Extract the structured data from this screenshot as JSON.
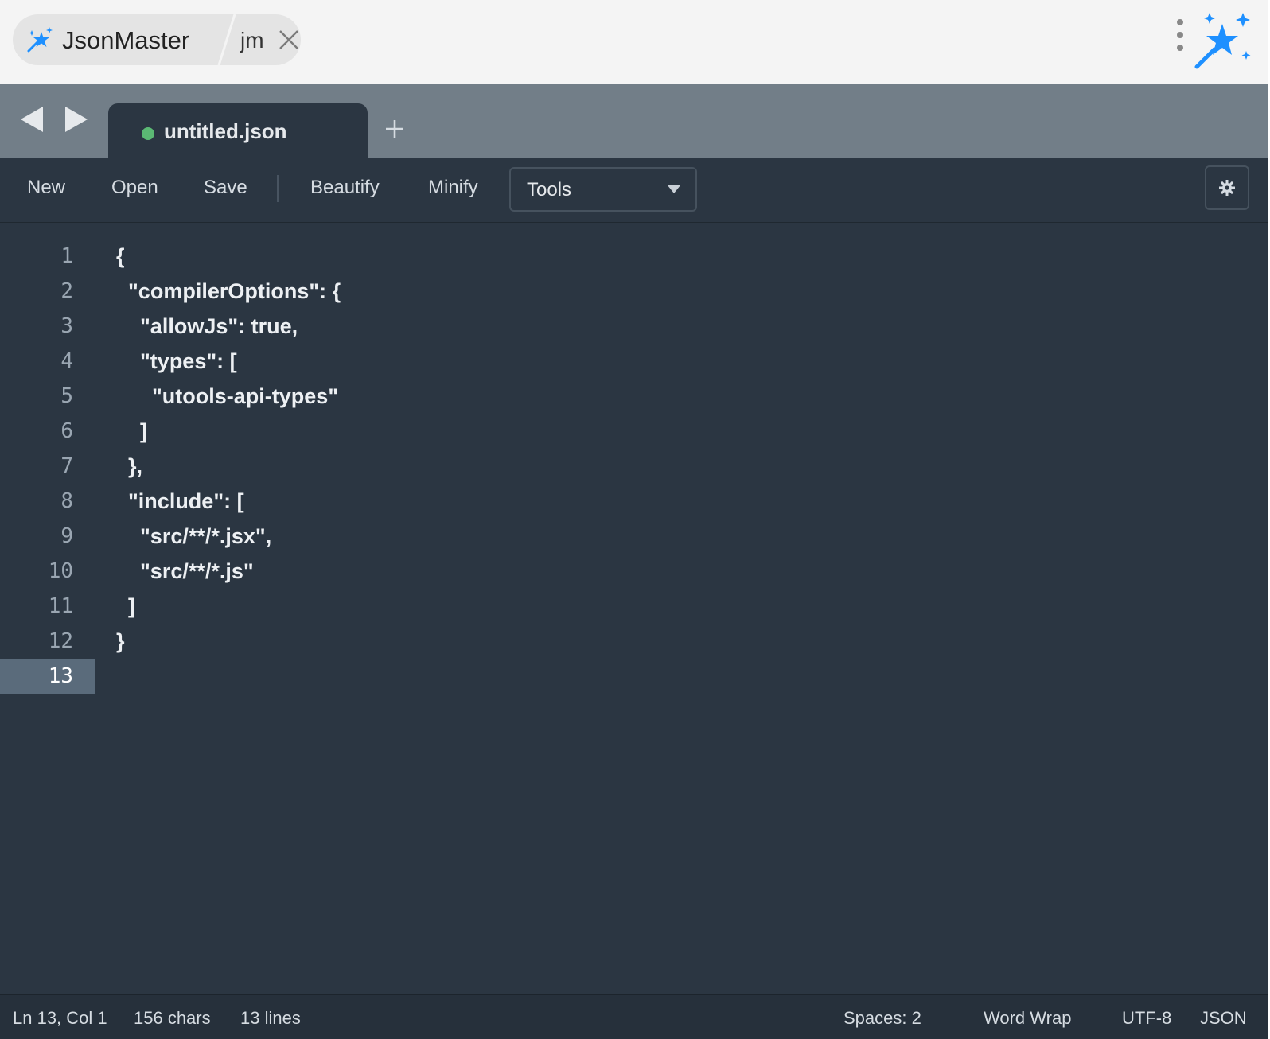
{
  "header": {
    "app_name": "JsonMaster",
    "sub_name": "jm",
    "accent_color": "#1e90ff"
  },
  "tabs": [
    {
      "label": "untitled.json",
      "status_color": "#5bb974"
    }
  ],
  "toolbar": {
    "new_label": "New",
    "open_label": "Open",
    "save_label": "Save",
    "beautify_label": "Beautify",
    "minify_label": "Minify",
    "tools_selected": "Tools"
  },
  "editor": {
    "active_line": 13,
    "lines": [
      {
        "num": "1",
        "text": "{"
      },
      {
        "num": "2",
        "text": "  \"compilerOptions\": {"
      },
      {
        "num": "3",
        "text": "    \"allowJs\": true,"
      },
      {
        "num": "4",
        "text": "    \"types\": ["
      },
      {
        "num": "5",
        "text": "      \"utools-api-types\""
      },
      {
        "num": "6",
        "text": "    ]"
      },
      {
        "num": "7",
        "text": "  },"
      },
      {
        "num": "8",
        "text": "  \"include\": ["
      },
      {
        "num": "9",
        "text": "    \"src/**/*.jsx\","
      },
      {
        "num": "10",
        "text": "    \"src/**/*.js\""
      },
      {
        "num": "11",
        "text": "  ]"
      },
      {
        "num": "12",
        "text": "}"
      },
      {
        "num": "13",
        "text": ""
      }
    ]
  },
  "status": {
    "cursor": "Ln 13, Col 1",
    "chars": "156 chars",
    "lines": "13 lines",
    "spaces": "Spaces: 2",
    "wrap": "Word Wrap",
    "encoding": "UTF-8",
    "language": "JSON"
  }
}
